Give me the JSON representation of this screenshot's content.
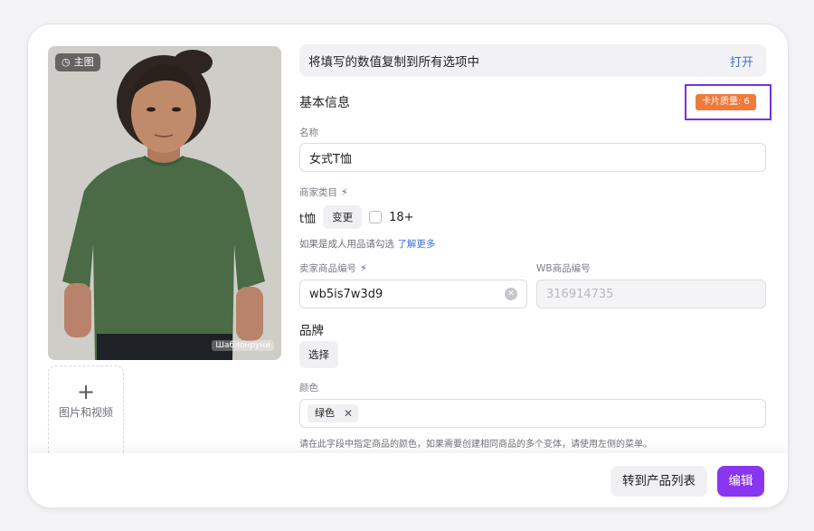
{
  "media": {
    "main_badge": "主图",
    "watermark": "Шаблонруни",
    "add_tile_label": "图片和视频"
  },
  "copy_bar": {
    "text": "将填写的数值复制到所有选项中",
    "action": "打开"
  },
  "basic_info": {
    "title": "基本信息",
    "card_quality": "卡片质量:  6"
  },
  "name": {
    "label": "名称",
    "value": "女式T恤"
  },
  "category": {
    "label": "商家类目",
    "value": "t恤",
    "change_button": "变更",
    "adult_checkbox_label": "18+",
    "hint": "如果是成人用品请勾选",
    "hint_link": "了解更多"
  },
  "seller_sku": {
    "label": "卖家商品编号",
    "value": "wb5is7w3d9"
  },
  "wb_sku": {
    "label": "WB商品编号",
    "value": "316914735"
  },
  "brand": {
    "title": "品牌",
    "select_button": "选择"
  },
  "color": {
    "label": "颜色",
    "tags": [
      "绿色"
    ],
    "hint": "请在此字段中指定商品的颜色，如果需要创建相同商品的多个变体，请使用左侧的菜单。"
  },
  "footer": {
    "to_list_button": "转到产品列表",
    "edit_button": "编辑"
  },
  "colors": {
    "accent": "#8a35ef",
    "highlight_border": "#7b2fe0",
    "quality_badge": "#f07a3a",
    "link": "#3b6fd8"
  }
}
